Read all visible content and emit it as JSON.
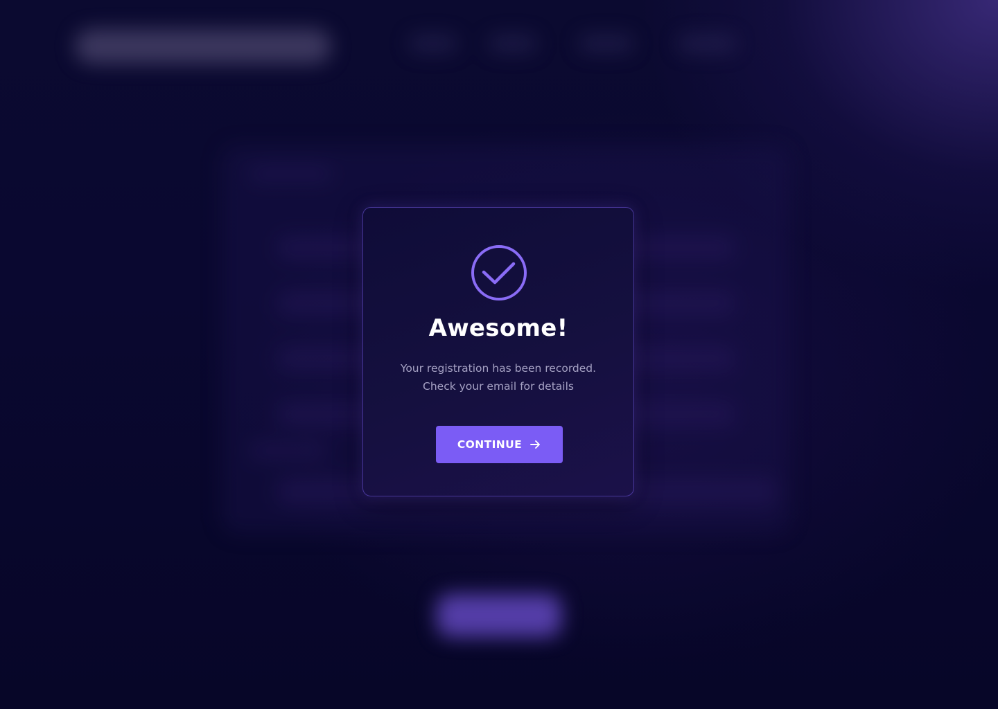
{
  "colors": {
    "accent": "#7b5cf5",
    "icon_stroke": "#8a6cf6",
    "background": "#07062a",
    "title": "#ffffff",
    "message": "#a6a2c4"
  },
  "modal": {
    "icon": "check-circle-icon",
    "title": "Awesome!",
    "message_line1": "Your registration has been recorded.",
    "message_line2": "Check your email for details",
    "button": {
      "label": "CONTINUE",
      "icon": "arrow-right-icon"
    }
  }
}
